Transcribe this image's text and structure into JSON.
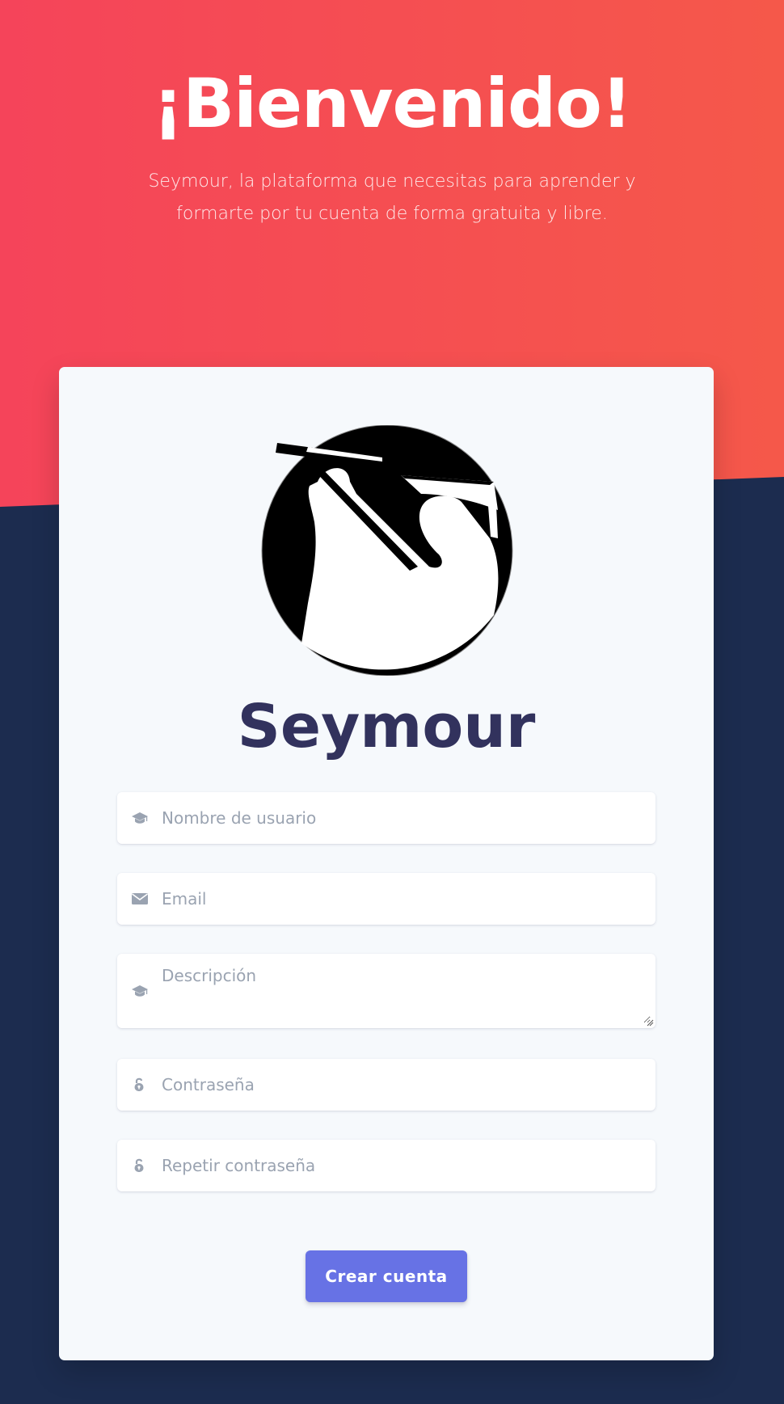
{
  "hero": {
    "title": "¡Bienvenido!",
    "subtitle": "Seymour, la plataforma que necesitas para aprender y formarte por tu cuenta de forma gratuita y libre."
  },
  "brand": {
    "name": "Seymour"
  },
  "form": {
    "username_placeholder": "Nombre de usuario",
    "email_placeholder": "Email",
    "description_placeholder": "Descripción",
    "password_placeholder": "Contraseña",
    "repeat_password_placeholder": "Repetir contraseña",
    "submit_label": "Crear cuenta"
  },
  "icons": {
    "username": "graduation-cap-icon",
    "email": "envelope-icon",
    "description": "graduation-cap-icon",
    "password": "unlock-icon",
    "repeat_password": "unlock-icon"
  },
  "colors": {
    "hero_gradient_start": "#f5445a",
    "hero_gradient_end": "#f5584a",
    "background": "#1c2c4f",
    "card": "#f6f9fc",
    "brand_text": "#32325d",
    "button": "#6772e5",
    "icon": "#9aa3b1"
  }
}
